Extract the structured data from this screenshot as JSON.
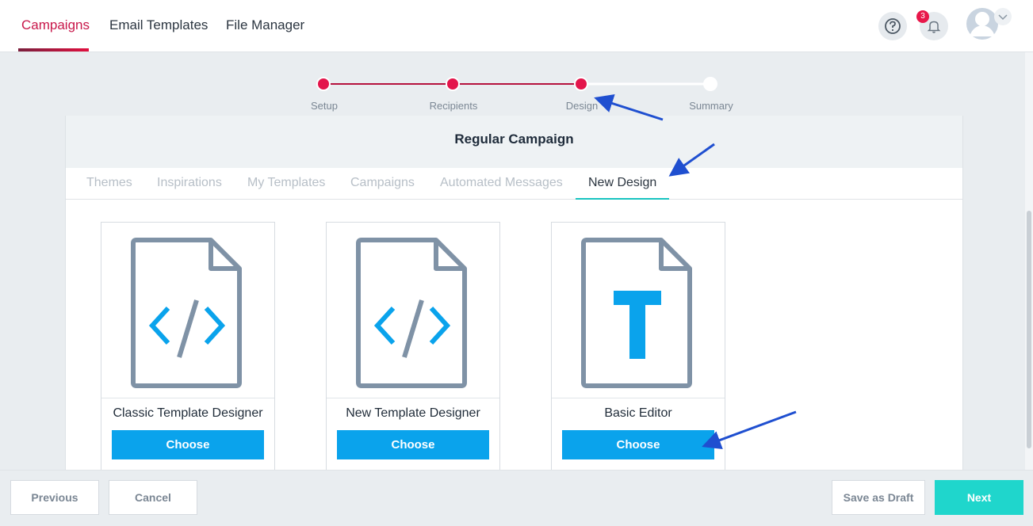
{
  "nav": {
    "items": [
      "Campaigns",
      "Email Templates",
      "File Manager"
    ],
    "notification_count": "3"
  },
  "stepper": {
    "steps": [
      "Setup",
      "Recipients",
      "Design",
      "Summary"
    ]
  },
  "panel": {
    "title": "Regular Campaign",
    "tabs": [
      "Themes",
      "Inspirations",
      "My Templates",
      "Campaigns",
      "Automated Messages",
      "New Design"
    ],
    "active_tab": "New Design"
  },
  "cards": [
    {
      "title": "Classic Template Designer",
      "button": "Choose",
      "icon": "code-file-icon"
    },
    {
      "title": "New Template Designer",
      "button": "Choose",
      "icon": "code-file-icon"
    },
    {
      "title": "Basic Editor",
      "button": "Choose",
      "icon": "text-file-icon"
    }
  ],
  "footer": {
    "previous": "Previous",
    "cancel": "Cancel",
    "save_draft": "Save as Draft",
    "next": "Next"
  },
  "colors": {
    "accent": "#c8174a",
    "button_blue": "#0aa3ec",
    "next_teal": "#1fd6cc",
    "annotation_arrow": "#1f4fd0"
  }
}
